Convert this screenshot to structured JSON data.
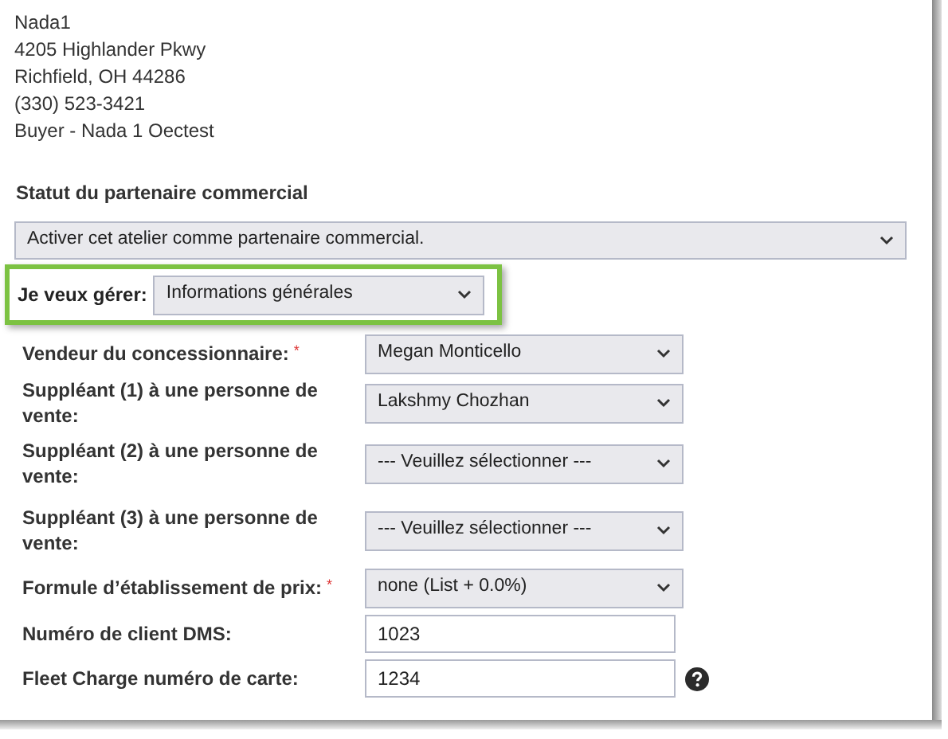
{
  "address": [
    "Nada1",
    "4205 Highlander Pkwy",
    "Richfield, OH 44286",
    "(330) 523-3421",
    "Buyer - Nada 1 Oectest"
  ],
  "partner_status": {
    "label": "Statut du partenaire commercial",
    "value": "Activer cet atelier comme partenaire commercial."
  },
  "manage": {
    "label": "Je veux gérer:",
    "value": "Informations générales",
    "highlighted": true
  },
  "fields": [
    {
      "kind": "select",
      "label": "Vendeur du concessionnaire:",
      "required_mark": "*",
      "value": "Megan Monticello"
    },
    {
      "kind": "select",
      "label": "Suppléant (1) à une personne de vente:",
      "value": "Lakshmy Chozhan"
    },
    {
      "kind": "select",
      "label": "Suppléant (2) à une personne de vente:",
      "value": "--- Veuillez sélectionner ---"
    },
    {
      "kind": "select",
      "label": "Suppléant (3) à une personne de vente:",
      "value": "--- Veuillez sélectionner ---"
    },
    {
      "kind": "select",
      "label": "Formule d’établissement de prix:",
      "required_mark": "*",
      "value": "none (List + 0.0%)"
    },
    {
      "kind": "input",
      "label": "Numéro de client DMS:",
      "value": "1023"
    },
    {
      "kind": "input",
      "label": "Fleet Charge numéro de carte:",
      "value": "1234",
      "help": true
    }
  ]
}
